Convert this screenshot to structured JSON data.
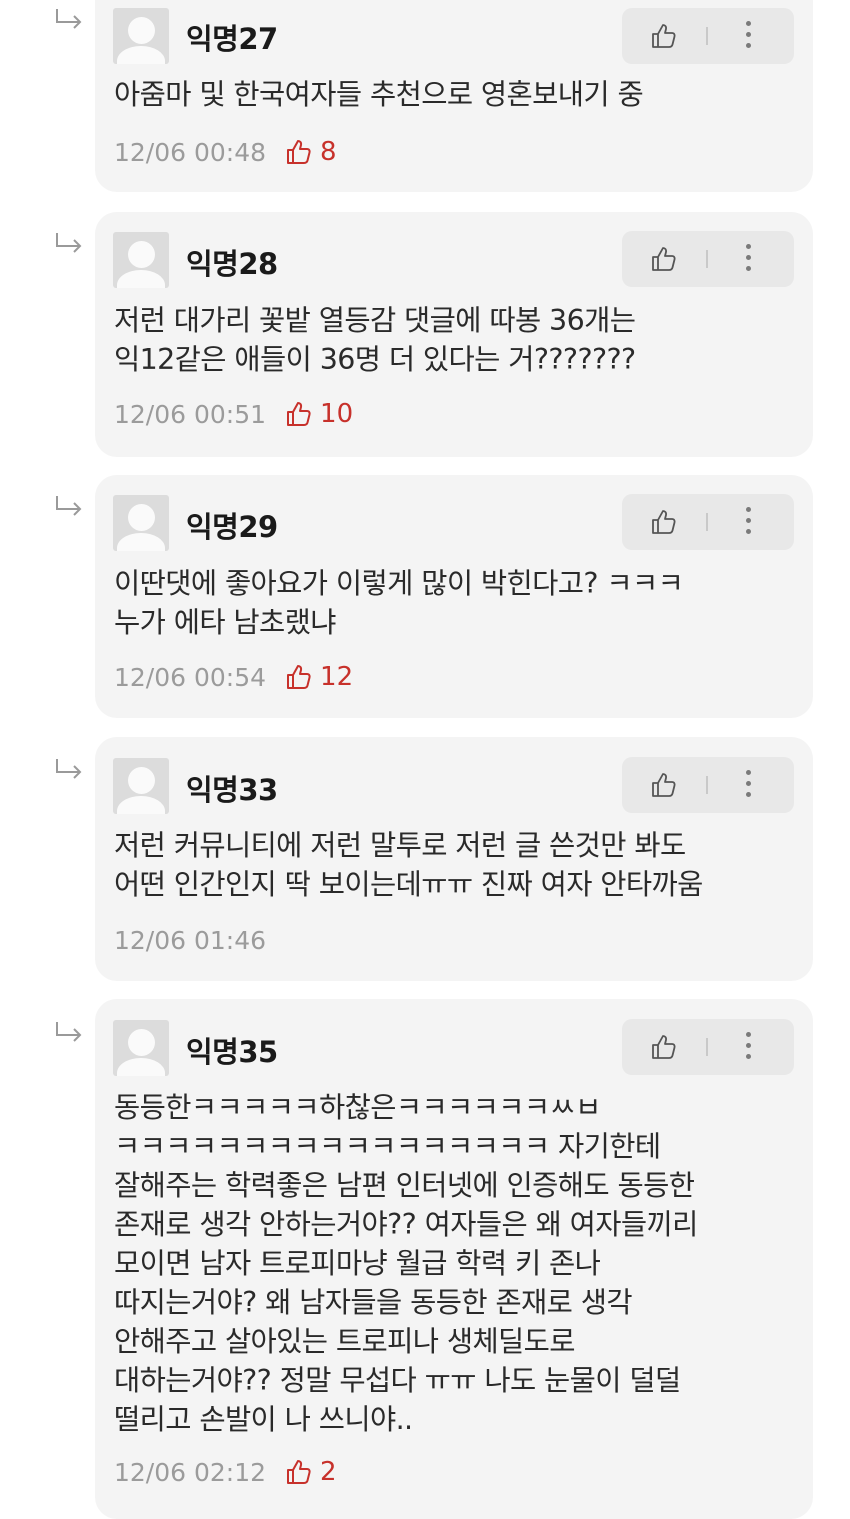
{
  "comments": [
    {
      "author": "익명27",
      "text": "아줌마 및 한국여자들 추천으로 영혼보내기 중",
      "timestamp": "12/06 00:48",
      "likes": "8"
    },
    {
      "author": "익명28",
      "text": "저런 대가리 꽃밭 열등감 댓글에 따봉 36개는\n익12같은 애들이 36명 더 있다는 거???????",
      "timestamp": "12/06 00:51",
      "likes": "10"
    },
    {
      "author": "익명29",
      "text": "이딴댓에 좋아요가 이렇게 많이 박힌다고? ㅋㅋㅋ\n누가 에타 남초랬냐",
      "timestamp": "12/06 00:54",
      "likes": "12"
    },
    {
      "author": "익명33",
      "text": "저런 커뮤니티에 저런 말투로 저런 글 쓴것만 봐도\n어떤 인간인지 딱 보이는데ㅠㅠ 진짜 여자 안타까움",
      "timestamp": "12/06 01:46",
      "likes": ""
    },
    {
      "author": "익명35",
      "text": "동등한ㅋㅋㅋㅋㅋ하찮은ㅋㅋㅋㅋㅋㅋㅆㅂ\nㅋㅋㅋㅋㅋㅋㅋㅋㅋㅋㅋㅋㅋㅋㅋㅋㅋ 자기한테\n잘해주는 학력좋은 남편 인터넷에 인증해도 동등한\n존재로 생각 안하는거야?? 여자들은 왜 여자들끼리\n모이면 남자 트로피마냥 월급 학력 키 존나\n따지는거야? 왜 남자들을 동등한 존재로 생각\n안해주고 살아있는 트로피나 생체딜도로\n대하는거야?? 정말 무섭다 ㅠㅠ 나도 눈물이 덜덜\n떨리고 손발이 나 쓰니야..",
      "timestamp": "12/06 02:12",
      "likes": "2"
    }
  ],
  "icons": {
    "reply": "reply-arrow-icon",
    "like": "thumbs-up-icon",
    "more": "more-vertical-icon",
    "avatar": "default-avatar-icon"
  },
  "colors": {
    "card_background": "#f4f4f4",
    "like_accent": "#c7312b",
    "meta_gray": "#9b9b9b"
  }
}
